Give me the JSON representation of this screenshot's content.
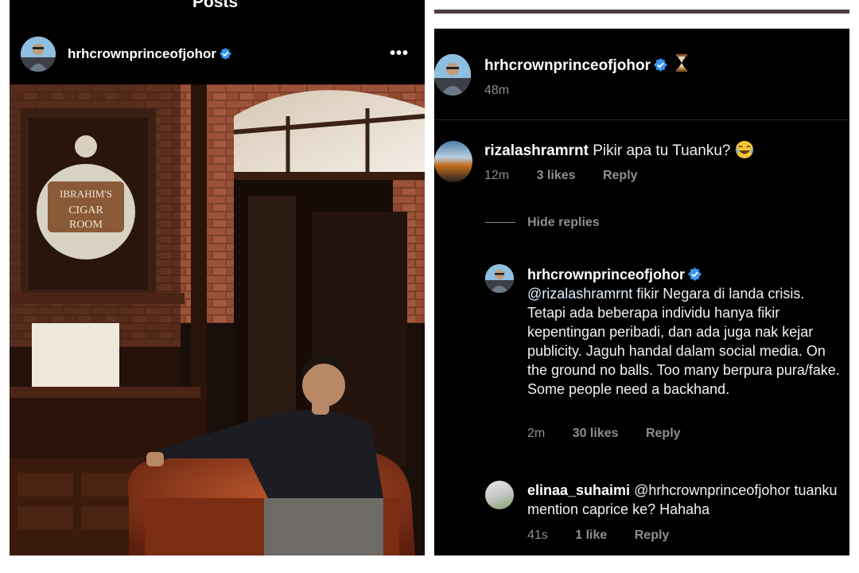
{
  "left_panel": {
    "page_title": "Posts",
    "post": {
      "username": "hrhcrownprinceofjohor",
      "more_glyph": "•••",
      "photo": {
        "plaque_lines": [
          "IBRAHIM'S",
          "CIGAR",
          "ROOM"
        ]
      }
    }
  },
  "right_panel": {
    "caption": {
      "username": "hrhcrownprinceofjohor",
      "time": "48m"
    },
    "comment": {
      "username": "rizalashramrnt",
      "text": "Pikir apa tu Tuanku?",
      "time": "12m",
      "likes": "3 likes",
      "reply_label": "Reply"
    },
    "hide_replies_label": "Hide replies",
    "replies": [
      {
        "username": "hrhcrownprinceofjohor",
        "mention": "@rizalashramrnt",
        "text": " fikir Negara di landa crisis. Tetapi ada beberapa individu hanya fikir kepentingan peribadi, dan ada juga nak kejar publicity. Jaguh handal dalam social media. On the ground no balls. Too many berpura pura/fake. Some people need a backhand.",
        "time": "2m",
        "likes": "30 likes",
        "reply_label": "Reply"
      },
      {
        "username": "elinaa_suhaimi",
        "text": "@hrhcrownprinceofjohor tuanku mention caprice ke? Hahaha",
        "time": "41s",
        "likes": "1 like",
        "reply_label": "Reply"
      }
    ]
  },
  "colors": {
    "background": "#000000",
    "verified_badge": "#3897f0",
    "meta_gray": "#8e8e8e",
    "divider": "#4a3e44"
  },
  "icons": [
    "verified-badge-icon",
    "more-options-icon",
    "hourglass-icon",
    "laughing-emoji-icon"
  ]
}
